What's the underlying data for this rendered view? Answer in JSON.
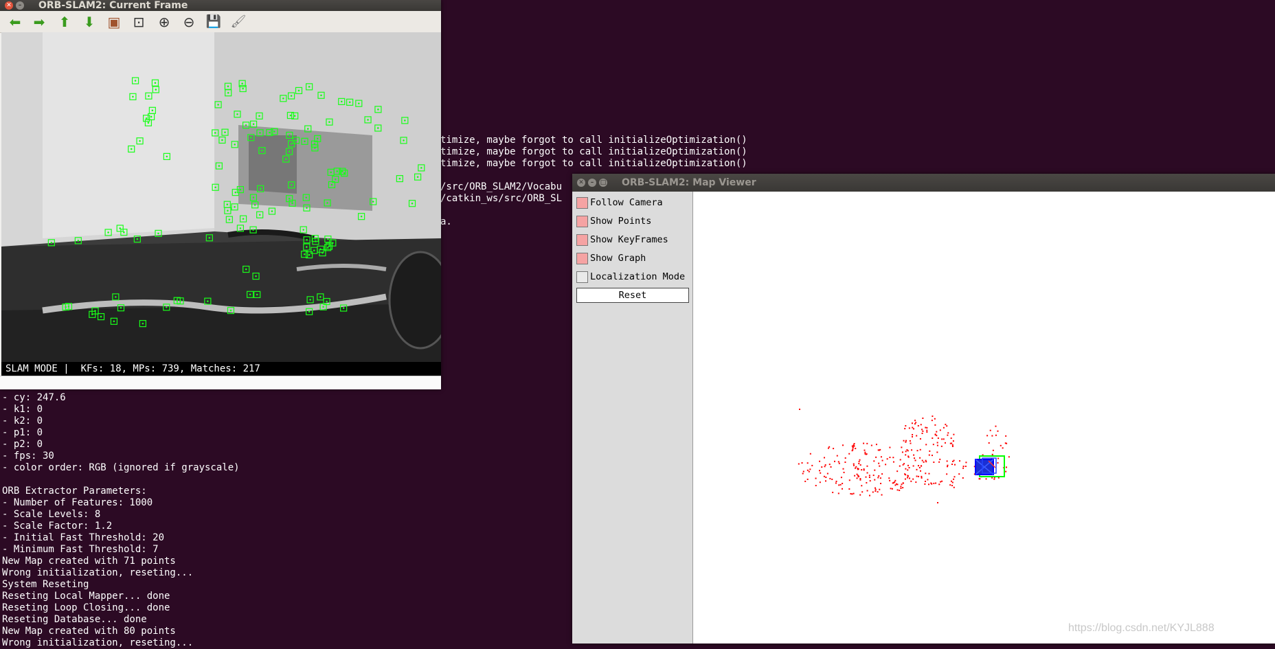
{
  "terminal": {
    "top_lines": [
      "timize, maybe forgot to call initializeOptimization()",
      "timize, maybe forgot to call initializeOptimization()",
      "timize, maybe forgot to call initializeOptimization()",
      "",
      "/src/ORB_SLAM2/Vocabu",
      "/catkin_ws/src/ORB_SL",
      "",
      "a."
    ],
    "bottom_lines": [
      "- cy: 247.6",
      "- k1: 0",
      "- k2: 0",
      "- p1: 0",
      "- p2: 0",
      "- fps: 30",
      "- color order: RGB (ignored if grayscale)",
      "",
      "ORB Extractor Parameters:",
      "- Number of Features: 1000",
      "- Scale Levels: 8",
      "- Scale Factor: 1.2",
      "- Initial Fast Threshold: 20",
      "- Minimum Fast Threshold: 7",
      "New Map created with 71 points",
      "Wrong initialization, reseting...",
      "System Reseting",
      "Reseting Local Mapper... done",
      "Reseting Loop Closing... done",
      "Reseting Database... done",
      "New Map created with 80 points",
      "Wrong initialization, reseting..."
    ]
  },
  "frame_window": {
    "title": "ORB-SLAM2: Current Frame",
    "toolbar": {
      "back": "⬅",
      "forward": "➡",
      "up": "⬆",
      "down": "⬇",
      "image": "▣",
      "zoom_fit": "⊡",
      "zoom_in": "⊕",
      "zoom_out": "⊖",
      "save": "💾",
      "brush": "🖌"
    },
    "status": "SLAM MODE |  KFs: 18, MPs: 739, Matches: 217",
    "colors": {
      "feature": "#19ff19",
      "camera_bg": "#5a5a5a"
    }
  },
  "map_window": {
    "title": "ORB-SLAM2: Map Viewer",
    "checkboxes": [
      {
        "label": "Follow Camera",
        "checked": true
      },
      {
        "label": "Show Points",
        "checked": true
      },
      {
        "label": "Show KeyFrames",
        "checked": true
      },
      {
        "label": "Show Graph",
        "checked": true
      },
      {
        "label": "Localization Mode",
        "checked": false
      }
    ],
    "reset_label": "Reset",
    "colors": {
      "points": "#ff0000",
      "keyframes": "#0000ff",
      "current_camera": "#00ff00"
    }
  },
  "watermark": "https://blog.csdn.net/KYJL888"
}
